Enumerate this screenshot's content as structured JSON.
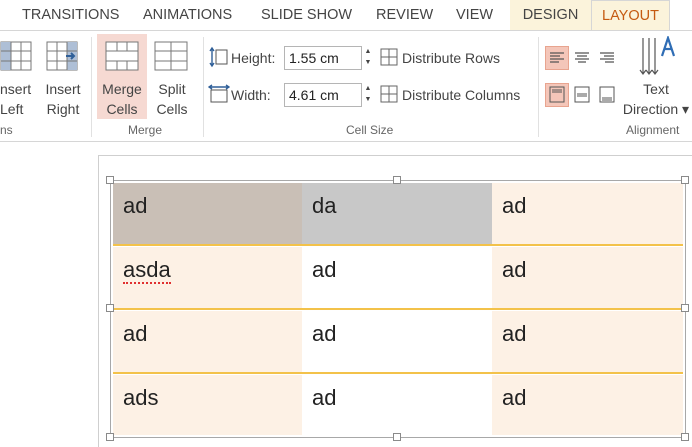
{
  "tabs": [
    "TRANSITIONS",
    "ANIMATIONS",
    "SLIDE SHOW",
    "REVIEW",
    "VIEW",
    "DESIGN",
    "LAYOUT"
  ],
  "ribbon": {
    "rows_columns": {
      "insert_left_line1": "nsert",
      "insert_left_line2": "Left",
      "insert_right_line1": "Insert",
      "insert_right_line2": "Right",
      "group_label": "ns"
    },
    "merge": {
      "merge_line1": "Merge",
      "merge_line2": "Cells",
      "split_line1": "Split",
      "split_line2": "Cells",
      "group_label": "Merge"
    },
    "cell_size": {
      "height_label": "Height:",
      "height_value": "1.55 cm",
      "width_label": "Width:",
      "width_value": "4.61 cm",
      "distribute_rows": "Distribute Rows",
      "distribute_columns": "Distribute Columns",
      "group_label": "Cell Size"
    },
    "alignment": {
      "text_direction_line1": "Text",
      "text_direction_line2": "Direction",
      "text_direction_caret": "▾",
      "group_label": "Alignment"
    }
  },
  "table": {
    "rows": [
      [
        "ad",
        "da",
        "ad"
      ],
      [
        "asda",
        "ad",
        "ad"
      ],
      [
        "ad",
        "ad",
        "ad"
      ],
      [
        "ads",
        "ad",
        "ad"
      ]
    ]
  },
  "colors": {
    "accent": "#c55a11",
    "merge_highlight": "#f6d9d2",
    "row_border": "#f3c24a",
    "cell_brown": "#c9bfb6",
    "cell_gray": "#c8c8c8",
    "cell_peach": "#fdf1e5"
  }
}
